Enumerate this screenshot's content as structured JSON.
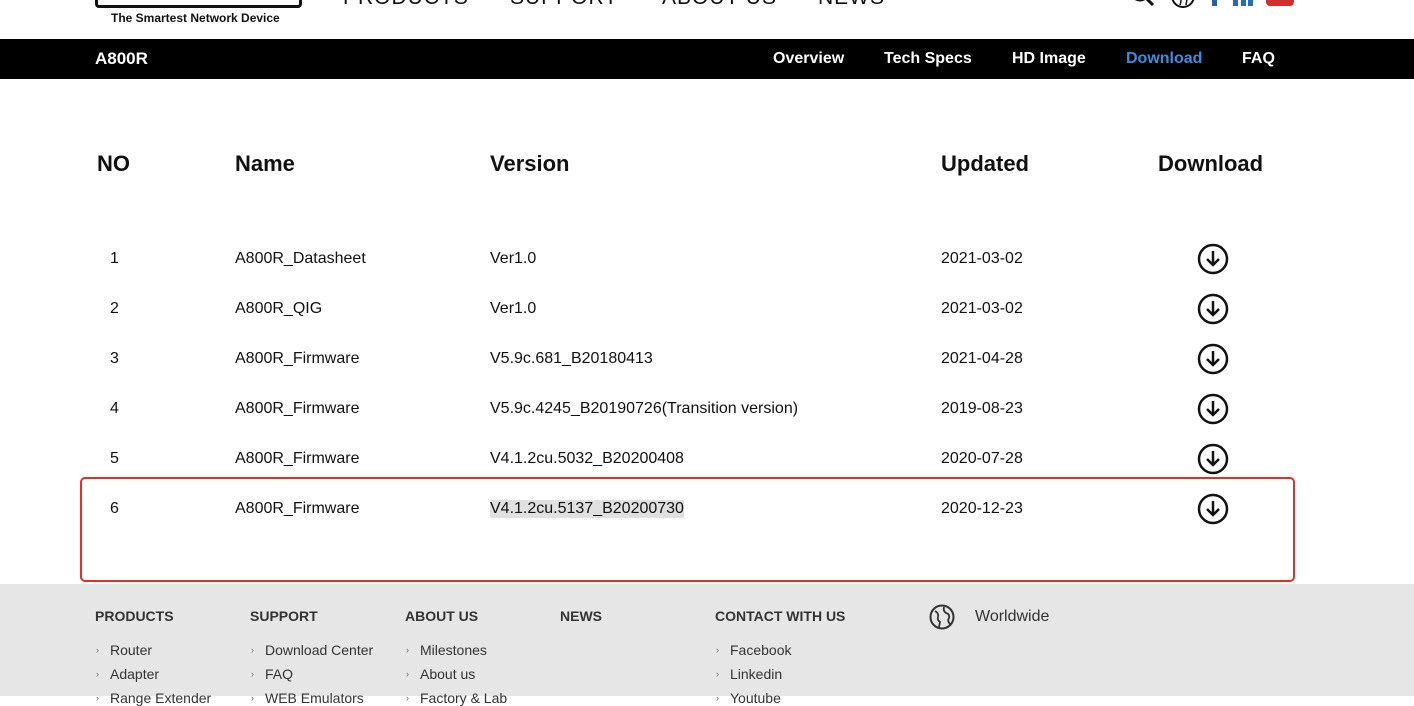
{
  "header": {
    "tagline": "The Smartest Network Device",
    "nav": [
      "PRODUCTS",
      "SUPPORT",
      "ABOUT US",
      "NEWS"
    ],
    "icons": [
      "search-icon",
      "globe-icon",
      "facebook-icon",
      "linkedin-icon",
      "youtube-icon"
    ]
  },
  "product_bar": {
    "title": "A800R",
    "links": [
      "Overview",
      "Tech Specs",
      "HD Image",
      "Download",
      "FAQ"
    ],
    "active": "Download",
    "colors": {
      "background": "#000000",
      "active_link": "#3b8de0"
    }
  },
  "table": {
    "headers": [
      "NO",
      "Name",
      "Version",
      "Updated",
      "Download"
    ],
    "rows": [
      {
        "no": "1",
        "name": "A800R_Datasheet",
        "version": "Ver1.0",
        "updated": "2021-03-02"
      },
      {
        "no": "2",
        "name": "A800R_QIG",
        "version": "Ver1.0",
        "updated": "2021-03-02"
      },
      {
        "no": "3",
        "name": "A800R_Firmware",
        "version": "V5.9c.681_B20180413",
        "updated": "2021-04-28"
      },
      {
        "no": "4",
        "name": "A800R_Firmware",
        "version": "V5.9c.4245_B20190726(Transition version)",
        "updated": "2019-08-23"
      },
      {
        "no": "5",
        "name": "A800R_Firmware",
        "version": "V4.1.2cu.5032_B20200408",
        "updated": "2020-07-28"
      },
      {
        "no": "6",
        "name": "A800R_Firmware",
        "version": "V4.1.2cu.5137_B20200730",
        "updated": "2020-12-23"
      }
    ],
    "download_icon": "download-circle-icon",
    "highlight_color": "#e0302a"
  },
  "footer": {
    "columns": [
      {
        "title": "PRODUCTS",
        "items": [
          "Router",
          "Adapter",
          "Range Extender"
        ]
      },
      {
        "title": "SUPPORT",
        "items": [
          "Download Center",
          "FAQ",
          "WEB Emulators"
        ]
      },
      {
        "title": "ABOUT US",
        "items": [
          "Milestones",
          "About us",
          "Factory & Lab"
        ]
      },
      {
        "title": "NEWS",
        "items": []
      },
      {
        "title": "CONTACT WITH US",
        "items": [
          "Facebook",
          "Linkedin",
          "Youtube"
        ]
      }
    ],
    "region": "Worldwide"
  }
}
